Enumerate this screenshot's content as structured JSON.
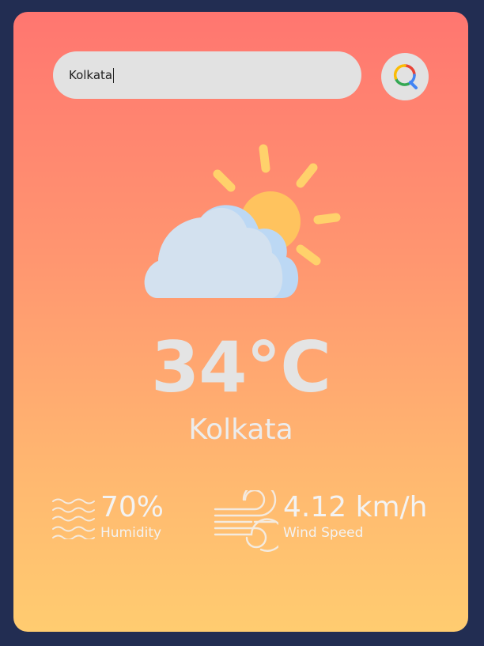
{
  "search": {
    "value": "Kolkata",
    "button_icon": "search-icon"
  },
  "weather": {
    "icon": "partly-cloudy-icon",
    "temperature": "34°C",
    "city": "Kolkata"
  },
  "details": {
    "humidity": {
      "icon": "humidity-waves-icon",
      "value": "70%",
      "label": "Humidity"
    },
    "wind": {
      "icon": "wind-icon",
      "value": "4.12 km/h",
      "label": "Wind Speed"
    }
  },
  "colors": {
    "page_background": "#222d52",
    "card_gradient_top": "#ff7670",
    "card_gradient_bottom": "#ffcc70",
    "input_background": "#e2e2e2",
    "text_light": "#ececec"
  }
}
